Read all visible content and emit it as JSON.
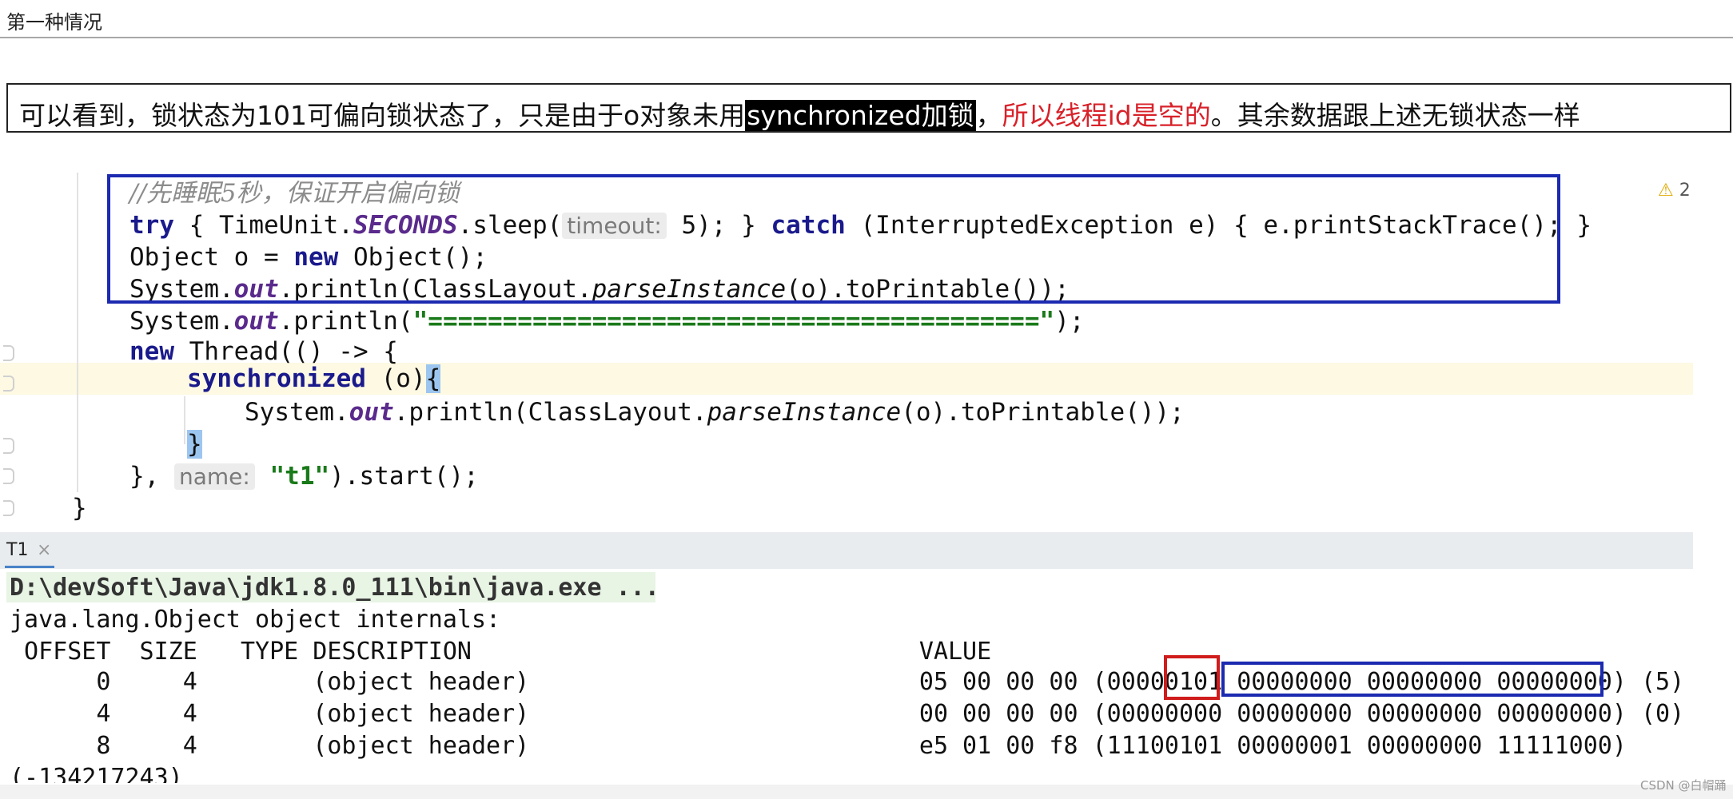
{
  "title": "第一种情况",
  "caption": {
    "part1": "可以看到，锁状态为101可偏向锁状态了，只是由于o对象未用",
    "highlight": "synchronized加锁",
    "part2": "，",
    "red_part": "所以线程id是空的",
    "part3": "。其余数据跟上述无锁状态一样"
  },
  "editor": {
    "warning_count": "2",
    "lines": {
      "comment": "//先睡眠5秒，保证开启偏向锁",
      "try_kw": "try",
      "try_a": " { TimeUnit.",
      "seconds": "SECONDS",
      "try_b": ".sleep(",
      "hint_timeout": "timeout:",
      "try_c": " 5); } ",
      "catch_kw": "catch",
      "try_d": " (InterruptedException e) { e.printStackTrace(); }",
      "obj_line": "Object o = ",
      "new_kw": "new",
      "obj_rest": " Object();",
      "sys": "System.",
      "out": "out",
      "println_a": ".println(ClassLayout.",
      "parse": "parseInstance",
      "println_b": "(o).toPrintable());",
      "println_c": ".println(",
      "equals_str": "\"=========================================\"",
      "println_d": ");",
      "thread_rest": " Thread(() -> {",
      "sync_kw": "synchronized",
      "sync_rest": " (o)",
      "open_brace": "{",
      "close_brace": "}",
      "close_thread": "},",
      "hint_name": "name:",
      "t1_str": "\"t1\"",
      "start_rest": ").start();",
      "method_close": "}"
    }
  },
  "run_panel": {
    "tab_label": "T1",
    "tab_close": "×",
    "console": [
      "D:\\devSoft\\Java\\jdk1.8.0_111\\bin\\java.exe ...",
      "java.lang.Object object internals:",
      " OFFSET  SIZE   TYPE DESCRIPTION                               VALUE",
      "      0     4        (object header)                           05 00 00 00 (00000101 00000000 00000000 00000000) (5)",
      "      4     4        (object header)                           00 00 00 00 (00000000 00000000 00000000 00000000) (0)",
      "      8     4        (object header)                           e5 01 00 f8 (11100101 00000001 00000000 11111000)",
      "(-134217243)"
    ]
  },
  "watermark": "CSDN @白帽踊"
}
